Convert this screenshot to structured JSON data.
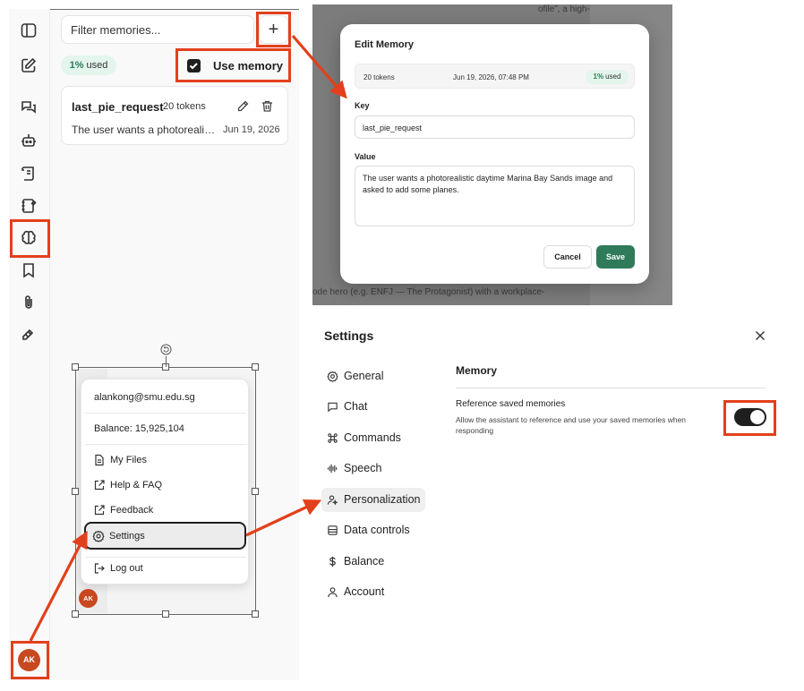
{
  "sidebar": {
    "icons": [
      "panel-toggle-icon",
      "new-chat-icon",
      "chats-icon",
      "assistants-icon",
      "prompts-icon",
      "notes-icon",
      "memory-icon",
      "bookmarks-icon",
      "attachments-icon",
      "tools-icon"
    ]
  },
  "memory_panel": {
    "filter_placeholder": "Filter memories...",
    "add_label": "+",
    "usage_percent": "1%",
    "usage_suffix": "used",
    "use_memory_label": "Use memory",
    "use_memory_checked": true,
    "entries": [
      {
        "key": "last_pie_request",
        "tokens": "20 tokens",
        "value_preview": "The user wants a photorealistic daytime Marina Bay Sands image and asked to add some planes.",
        "date": "Jun 19, 2026"
      }
    ]
  },
  "user_menu": {
    "email": "alankong@smu.edu.sg",
    "balance": "Balance: 15,925,104",
    "items": [
      "My Files",
      "Help & FAQ",
      "Feedback",
      "Settings",
      "Log out"
    ],
    "avatar_initials": "AK"
  },
  "edit_memory": {
    "title": "Edit Memory",
    "tokens": "20 tokens",
    "date": "Jun 19, 2026, 07:48 PM",
    "usage_percent": "1%",
    "usage_suffix": "used",
    "key_label": "Key",
    "key_value": "last_pie_request",
    "value_label": "Value",
    "value_text": "The user wants a photorealistic daytime Marina Bay Sands image and asked to add some planes.",
    "cancel_label": "Cancel",
    "save_label": "Save"
  },
  "settings": {
    "title": "Settings",
    "nav": [
      {
        "label": "General",
        "icon": "gear-icon"
      },
      {
        "label": "Chat",
        "icon": "chat-bubble-icon"
      },
      {
        "label": "Commands",
        "icon": "command-icon"
      },
      {
        "label": "Speech",
        "icon": "waveform-icon"
      },
      {
        "label": "Personalization",
        "icon": "person-sparkle-icon"
      },
      {
        "label": "Data controls",
        "icon": "database-icon"
      },
      {
        "label": "Balance",
        "icon": "dollar-icon"
      },
      {
        "label": "Account",
        "icon": "user-icon"
      }
    ],
    "active_nav": "Personalization",
    "section_title": "Memory",
    "option_title": "Reference saved memories",
    "option_description": "Allow the assistant to reference and use your saved memories when responding",
    "option_enabled": true
  },
  "colors": {
    "highlight": "#e2401c",
    "accent_green": "#2f7a5a",
    "avatar": "#c8481f"
  }
}
